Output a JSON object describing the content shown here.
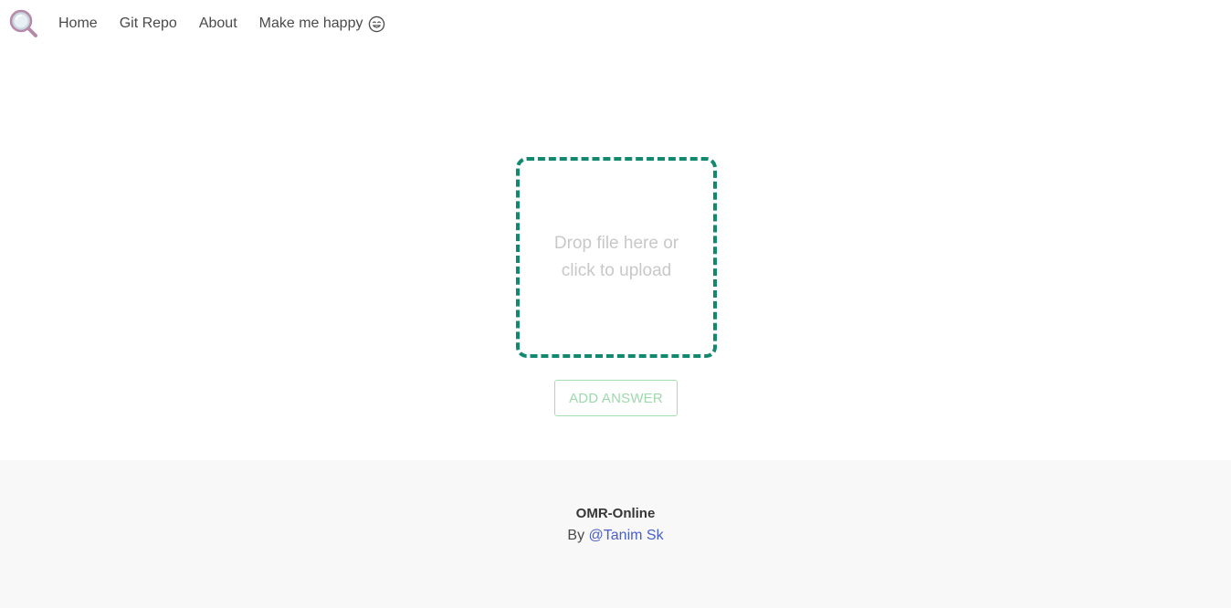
{
  "navbar": {
    "logo_icon": "magnifier-icon",
    "links": [
      {
        "label": "Home"
      },
      {
        "label": "Git Repo"
      },
      {
        "label": "About"
      },
      {
        "label": "Make me happy",
        "icon": "smile-icon"
      }
    ]
  },
  "upload": {
    "prompt": "Drop file here or click to upload",
    "border_color": "#11896f"
  },
  "actions": {
    "add_answer_label": "ADD ANSWER"
  },
  "footer": {
    "title": "OMR-Online",
    "by_prefix": "By",
    "author_link": "@Tanim Sk"
  }
}
